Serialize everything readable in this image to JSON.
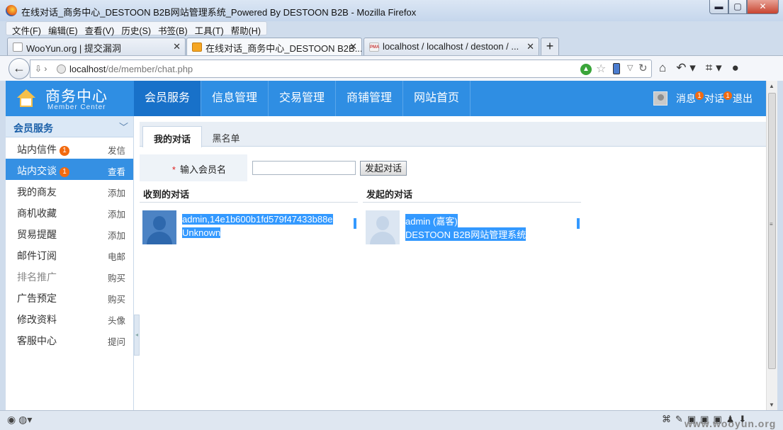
{
  "window": {
    "title": "在线对话_商务中心_DESTOON B2B网站管理系统_Powered By DESTOON B2B - Mozilla Firefox",
    "buttons": {
      "minimize": "▬",
      "maximize": "▢",
      "close": "✕"
    }
  },
  "menubar": [
    "文件(F)",
    "编辑(E)",
    "查看(V)",
    "历史(S)",
    "书签(B)",
    "工具(T)",
    "帮助(H)"
  ],
  "tabs": [
    {
      "label": "WooYun.org | 提交漏洞",
      "active": false
    },
    {
      "label": "在线对话_商务中心_DESTOON B2B...",
      "active": true
    },
    {
      "label": "localhost / localhost / destoon / ...",
      "active": false
    }
  ],
  "address": {
    "host": "localhost",
    "path": "/de/member/chat.php"
  },
  "header": {
    "logo_title": "商务中心",
    "logo_subtitle": "Member Center",
    "nav": [
      "会员服务",
      "信息管理",
      "交易管理",
      "商铺管理",
      "网站首页"
    ],
    "active_nav": 0,
    "messages_label": "消息",
    "messages_badge": "1",
    "chat_label": "对话",
    "chat_badge": "1",
    "logout_label": "退出"
  },
  "sidebar": {
    "title": "会员服务",
    "items": [
      {
        "label": "站内信件",
        "badge": "1",
        "action": "发信"
      },
      {
        "label": "站内交谈",
        "badge": "1",
        "action": "查看",
        "selected": true
      },
      {
        "label": "我的商友",
        "action": "添加"
      },
      {
        "label": "商机收藏",
        "action": "添加"
      },
      {
        "label": "贸易提醒",
        "action": "添加"
      },
      {
        "label": "邮件订阅",
        "action": "电邮"
      },
      {
        "label": "排名推广",
        "action": "购买",
        "dim": true
      },
      {
        "label": "广告预定",
        "action": "购买"
      },
      {
        "label": "修改资料",
        "action": "头像"
      },
      {
        "label": "客服中心",
        "action": "提问"
      }
    ]
  },
  "content": {
    "tabs": [
      "我的对话",
      "黑名单"
    ],
    "form": {
      "required_mark": "*",
      "label": "输入会员名",
      "input_value": "",
      "button": "发起对话"
    },
    "received": {
      "title": "收到的对话",
      "line1": "admin,14e1b600b1fd579f47433b88e",
      "line2": "Unknown"
    },
    "started": {
      "title": "发起的对话",
      "line1": "admin (嘉客)",
      "line2": "DESTOON B2B网站管理系统"
    }
  },
  "statusbar": {
    "watermark": "www.wooyun.org"
  },
  "colors": {
    "header_blue": "#2f8ee3",
    "active_nav": "#1871c9",
    "badge": "#f26a10",
    "selection": "#3399ff"
  }
}
